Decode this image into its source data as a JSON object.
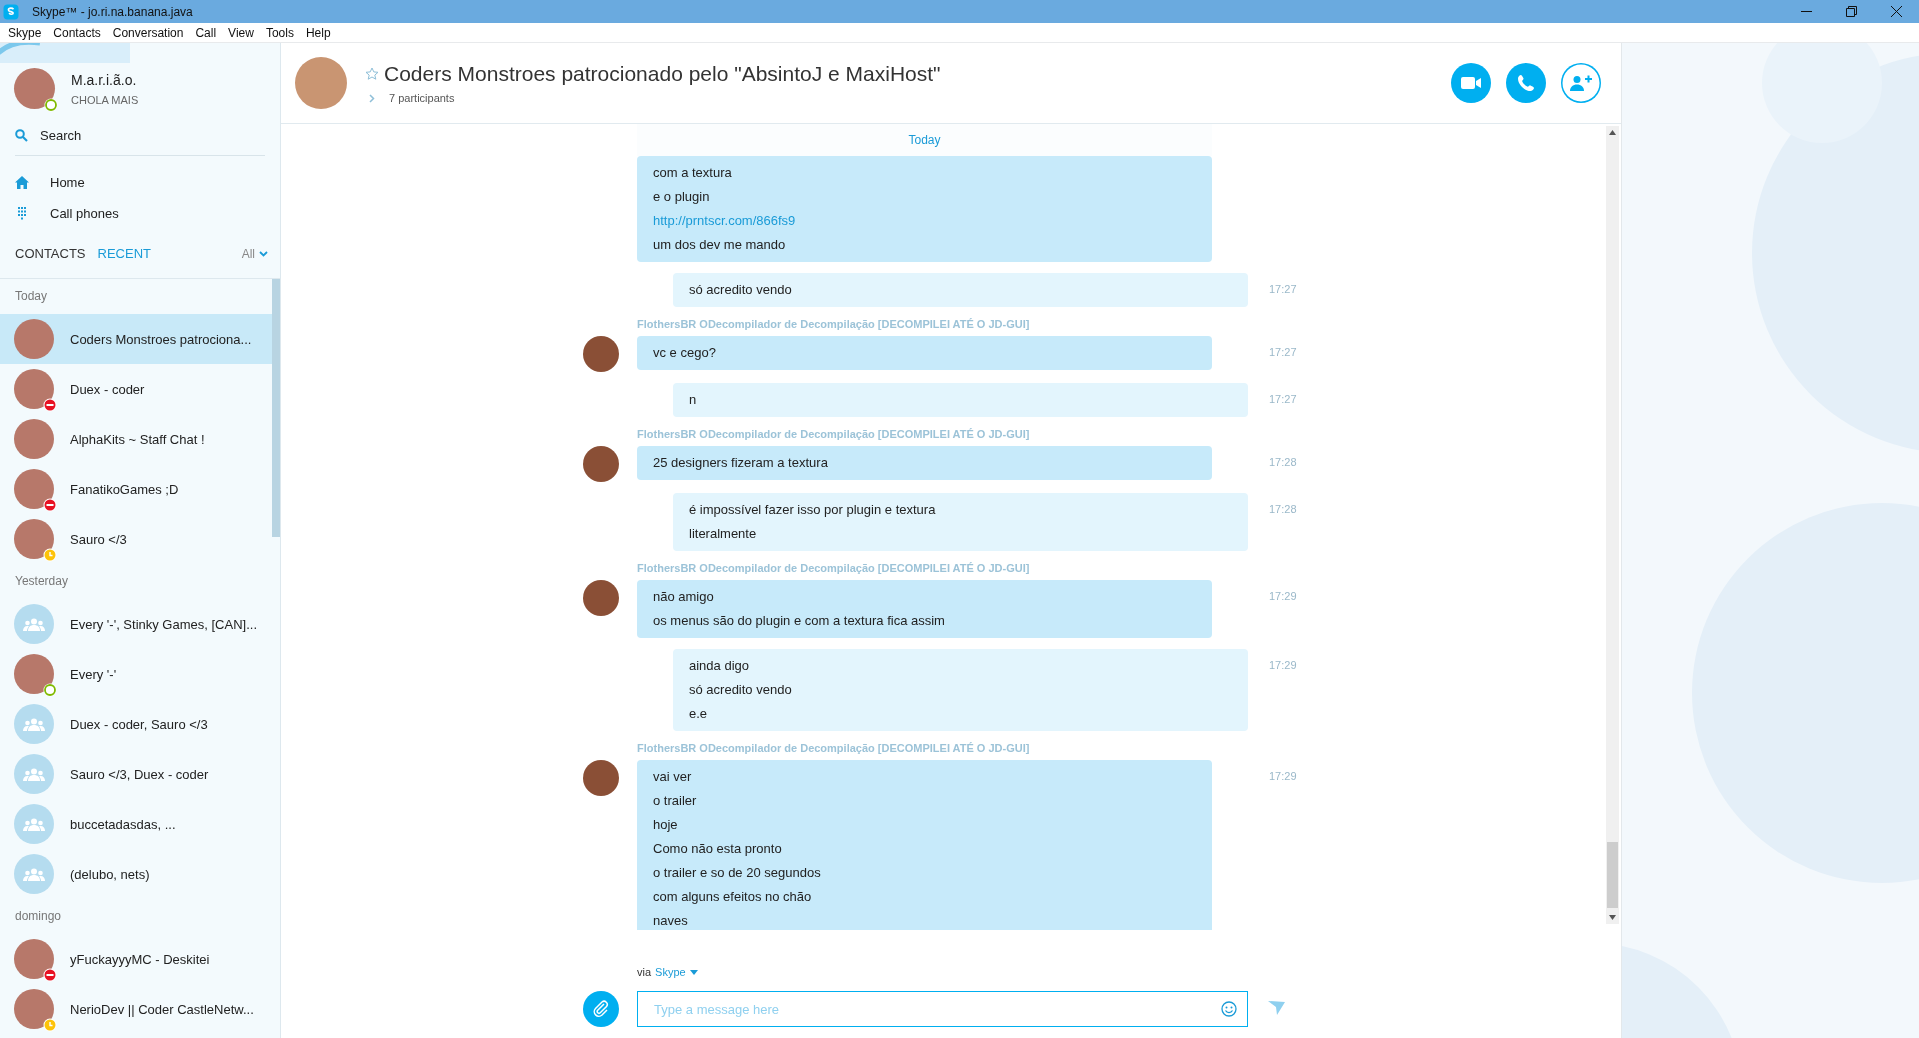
{
  "window": {
    "title": "Skype™ - jo.ri.na.banana.java"
  },
  "menu": [
    "Skype",
    "Contacts",
    "Conversation",
    "Call",
    "View",
    "Tools",
    "Help"
  ],
  "profile": {
    "name": "M.a.r.i.ã.o.",
    "mood": "CHOLA MAIS",
    "online": true
  },
  "search": {
    "label": "Search"
  },
  "nav": [
    {
      "label": "Home"
    },
    {
      "label": "Call phones"
    }
  ],
  "list_tabs": [
    {
      "label": "CONTACTS",
      "selected": false
    },
    {
      "label": "RECENT",
      "selected": true
    }
  ],
  "filter": {
    "label": "All"
  },
  "recent": [
    {
      "heading": "Today",
      "items": [
        {
          "name": "Coders Monstroes patrociona...",
          "kind": "contact",
          "busy": false,
          "away": false,
          "online": false,
          "selected": true
        },
        {
          "name": "Duex - coder",
          "kind": "contact",
          "busy": true,
          "away": false,
          "online": false,
          "selected": false
        },
        {
          "name": "AlphaKits ~ Staff Chat !",
          "kind": "contact",
          "busy": false,
          "away": false,
          "online": false,
          "selected": false
        },
        {
          "name": "FanatikoGames ;D",
          "kind": "contact",
          "busy": true,
          "away": false,
          "online": false,
          "selected": false
        },
        {
          "name": "Sauro </3",
          "kind": "contact",
          "busy": false,
          "away": true,
          "online": false,
          "selected": false
        }
      ]
    },
    {
      "heading": "Yesterday",
      "items": [
        {
          "name": "Every '-', Stinky Games, [CAN]...",
          "kind": "group",
          "busy": false,
          "away": false,
          "online": false,
          "selected": false
        },
        {
          "name": "Every '-'",
          "kind": "contact",
          "busy": false,
          "away": false,
          "online": true,
          "selected": false
        },
        {
          "name": "Duex - coder, Sauro </3",
          "kind": "group",
          "busy": false,
          "away": false,
          "online": false,
          "selected": false
        },
        {
          "name": "Sauro </3, Duex - coder",
          "kind": "group",
          "busy": false,
          "away": false,
          "online": false,
          "selected": false
        },
        {
          "name": "buccetadasdas, ...",
          "kind": "group",
          "busy": false,
          "away": false,
          "online": false,
          "selected": false
        },
        {
          "name": "(delubo, nets)",
          "kind": "group",
          "busy": false,
          "away": false,
          "online": false,
          "selected": false
        }
      ]
    },
    {
      "heading": "domingo",
      "items": [
        {
          "name": "yFuckayyyMC - Deskitei",
          "kind": "contact",
          "busy": true,
          "away": false,
          "online": false,
          "selected": false
        },
        {
          "name": "NerioDev || Coder CastleNetw...",
          "kind": "contact",
          "busy": false,
          "away": true,
          "online": false,
          "selected": false
        }
      ]
    }
  ],
  "conversation": {
    "title": "Coders Monstroes patrocionado pelo \"AbsintoJ e MaxiHost\"",
    "participants": "7 participants",
    "favorite": false
  },
  "day_banner": "Today",
  "messages": [
    {
      "kind": "incoming",
      "lines": [
        {
          "kind": "text",
          "text": "com a textura"
        },
        {
          "kind": "text",
          "text": "e o plugin"
        },
        {
          "kind": "link",
          "text": "http://prntscr.com/866fs9"
        },
        {
          "kind": "text",
          "text": "um dos dev me mando"
        }
      ]
    },
    {
      "kind": "outgoing",
      "time": "17:27",
      "lines": [
        {
          "kind": "text",
          "text": "só acredito vendo"
        }
      ]
    },
    {
      "kind": "incoming",
      "sender": "FlothersBR ODecompilador de Decompilação [DECOMPILEI ATÉ O JD-GUI]",
      "time": "17:27",
      "lines": [
        {
          "kind": "text",
          "text": "vc e cego?"
        }
      ]
    },
    {
      "kind": "outgoing",
      "time": "17:27",
      "lines": [
        {
          "kind": "text",
          "text": "n"
        }
      ]
    },
    {
      "kind": "incoming",
      "sender": "FlothersBR ODecompilador de Decompilação [DECOMPILEI ATÉ O JD-GUI]",
      "time": "17:28",
      "lines": [
        {
          "kind": "text",
          "text": "25 designers fizeram a textura"
        }
      ]
    },
    {
      "kind": "outgoing",
      "time": "17:28",
      "lines": [
        {
          "kind": "text",
          "text": "é impossível fazer isso por plugin e textura"
        },
        {
          "kind": "text",
          "text": "literalmente"
        }
      ]
    },
    {
      "kind": "incoming",
      "sender": "FlothersBR ODecompilador de Decompilação [DECOMPILEI ATÉ O JD-GUI]",
      "time": "17:29",
      "lines": [
        {
          "kind": "text",
          "text": "não amigo"
        },
        {
          "kind": "text",
          "text": "os menus são do plugin e com a textura fica assim"
        }
      ]
    },
    {
      "kind": "outgoing",
      "time": "17:29",
      "lines": [
        {
          "kind": "text",
          "text": "ainda digo"
        },
        {
          "kind": "text",
          "text": "só acredito vendo"
        },
        {
          "kind": "text",
          "text": "e.e"
        }
      ]
    },
    {
      "kind": "incoming",
      "sender": "FlothersBR ODecompilador de Decompilação [DECOMPILEI ATÉ O JD-GUI]",
      "time": "17:29",
      "lines": [
        {
          "kind": "text",
          "text": "vai ver"
        },
        {
          "kind": "text",
          "text": "o trailer"
        },
        {
          "kind": "text",
          "text": "hoje"
        },
        {
          "kind": "text",
          "text": "Como não esta pronto"
        },
        {
          "kind": "text",
          "text": "o trailer e so de 20 segundos"
        },
        {
          "kind": "text",
          "text": "com alguns efeitos no chão"
        },
        {
          "kind": "text",
          "text": "naves"
        }
      ]
    }
  ],
  "composer": {
    "via": "via",
    "service": "Skype",
    "placeholder": "Type a message here"
  }
}
